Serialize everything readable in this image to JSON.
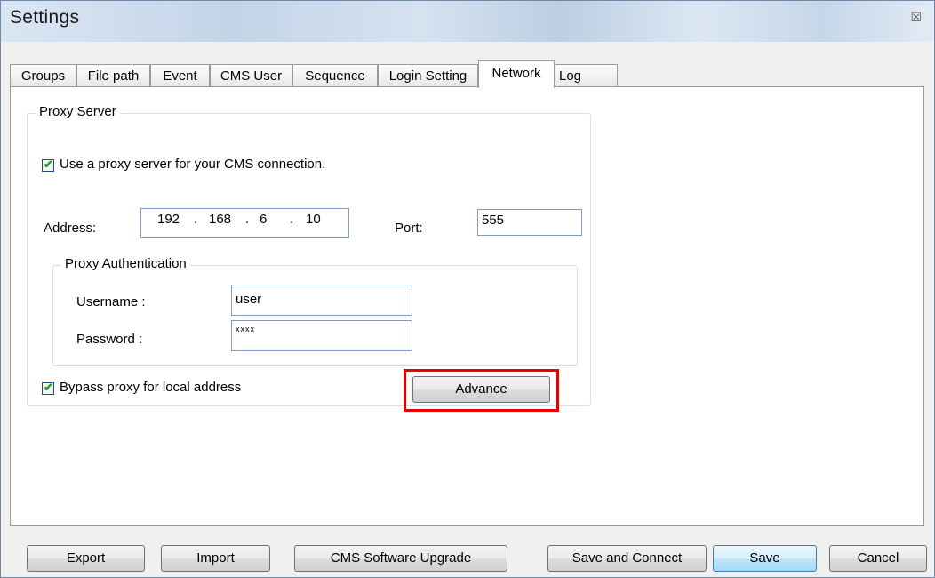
{
  "window": {
    "title": "Settings",
    "close_glyph": "☒"
  },
  "tabs": [
    {
      "label": "Groups"
    },
    {
      "label": "File path"
    },
    {
      "label": "Event"
    },
    {
      "label": "CMS User"
    },
    {
      "label": "Sequence"
    },
    {
      "label": "Login Setting"
    },
    {
      "label": "Network",
      "active": true
    },
    {
      "label": "Log"
    }
  ],
  "proxy": {
    "group_title": "Proxy Server",
    "use_proxy_label": "Use a proxy server for your CMS connection.",
    "use_proxy_checked": true,
    "address_label": "Address:",
    "address_octets": [
      "192",
      "168",
      "6",
      "10"
    ],
    "ip_dot": ".",
    "port_label": "Port:",
    "port_value": "555",
    "auth": {
      "group_title": "Proxy Authentication",
      "username_label": "Username :",
      "username_value": "user",
      "password_label": "Password :",
      "password_value": "xxxx"
    },
    "bypass_label": "Bypass proxy for local address",
    "bypass_checked": true,
    "advance_label": "Advance"
  },
  "checkmark": "✔",
  "footer": {
    "export": "Export",
    "import": "Import",
    "upgrade": "CMS Software Upgrade",
    "save_connect": "Save and Connect",
    "save": "Save",
    "cancel": "Cancel"
  },
  "colors": {
    "highlight": "#e60000",
    "title_bar": "#c3d4e8",
    "checkmark": "#21a121"
  }
}
